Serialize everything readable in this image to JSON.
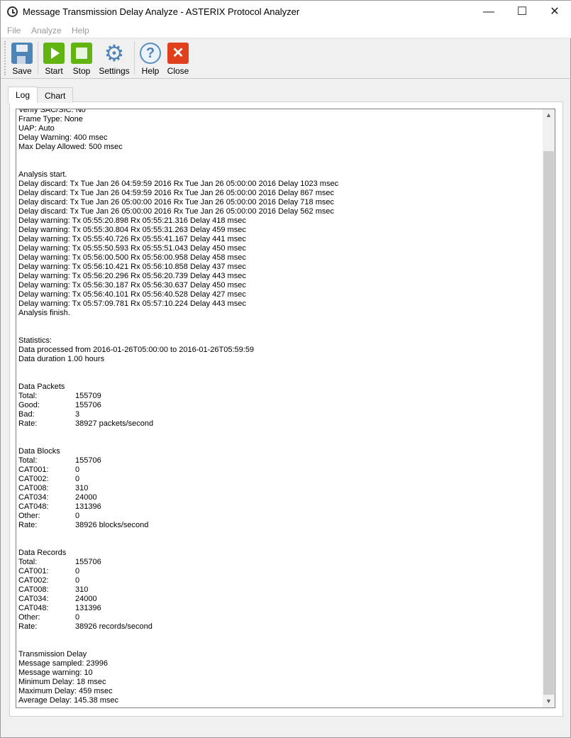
{
  "window": {
    "title": "Message Transmission Delay Analyze - ASTERIX Protocol Analyzer",
    "minimize": "—",
    "maximize": "☐",
    "close": "✕"
  },
  "menu": [
    "File",
    "Analyze",
    "Help"
  ],
  "toolbar": {
    "save": "Save",
    "start": "Start",
    "stop": "Stop",
    "settings": "Settings",
    "help": "Help",
    "close": "Close"
  },
  "tabs": [
    "Log",
    "Chart"
  ],
  "log": [
    {
      "t": "Verify SAC/SIC: No"
    },
    {
      "t": "Frame Type: None"
    },
    {
      "t": "UAP: Auto"
    },
    {
      "t": "Delay Warning: 400 msec"
    },
    {
      "t": "Max Delay Allowed: 500 msec"
    },
    {
      "t": ""
    },
    {
      "t": ""
    },
    {
      "t": "Analysis start."
    },
    {
      "t": "Delay discard: Tx Tue Jan 26 04:59:59 2016 Rx Tue Jan 26 05:00:00 2016 Delay 1023 msec"
    },
    {
      "t": "Delay discard: Tx Tue Jan 26 04:59:59 2016 Rx Tue Jan 26 05:00:00 2016 Delay 867 msec"
    },
    {
      "t": "Delay discard: Tx Tue Jan 26 05:00:00 2016 Rx Tue Jan 26 05:00:00 2016 Delay 718 msec"
    },
    {
      "t": "Delay discard: Tx Tue Jan 26 05:00:00 2016 Rx Tue Jan 26 05:00:00 2016 Delay 562 msec"
    },
    {
      "t": "Delay warning: Tx 05:55:20.898 Rx 05:55:21.316 Delay 418 msec"
    },
    {
      "t": "Delay warning: Tx 05:55:30.804 Rx 05:55:31.263 Delay 459 msec"
    },
    {
      "t": "Delay warning: Tx 05:55:40.726 Rx 05:55:41.167 Delay 441 msec"
    },
    {
      "t": "Delay warning: Tx 05:55:50.593 Rx 05:55:51.043 Delay 450 msec"
    },
    {
      "t": "Delay warning: Tx 05:56:00.500 Rx 05:56:00.958 Delay 458 msec"
    },
    {
      "t": "Delay warning: Tx 05:56:10.421 Rx 05:56:10.858 Delay 437 msec"
    },
    {
      "t": "Delay warning: Tx 05:56:20.296 Rx 05:56:20.739 Delay 443 msec"
    },
    {
      "t": "Delay warning: Tx 05:56:30.187 Rx 05:56:30.637 Delay 450 msec"
    },
    {
      "t": "Delay warning: Tx 05:56:40.101 Rx 05:56:40.528 Delay 427 msec"
    },
    {
      "t": "Delay warning: Tx 05:57:09.781 Rx 05:57:10.224 Delay 443 msec"
    },
    {
      "t": "Analysis finish."
    },
    {
      "t": ""
    },
    {
      "t": ""
    },
    {
      "t": "Statistics:"
    },
    {
      "t": "Data processed from 2016-01-26T05:00:00 to 2016-01-26T05:59:59"
    },
    {
      "t": "Data duration 1.00 hours"
    },
    {
      "t": ""
    },
    {
      "t": ""
    },
    {
      "t": "Data Packets"
    },
    {
      "k": "Total:",
      "v": "155709"
    },
    {
      "k": "Good:",
      "v": "155706"
    },
    {
      "k": "Bad:",
      "v": "3"
    },
    {
      "k": "Rate:",
      "v": "38927 packets/second"
    },
    {
      "t": ""
    },
    {
      "t": ""
    },
    {
      "t": "Data Blocks"
    },
    {
      "k": "Total:",
      "v": "155706"
    },
    {
      "k": "CAT001:",
      "v": "0"
    },
    {
      "k": "CAT002:",
      "v": "0"
    },
    {
      "k": "CAT008:",
      "v": "310"
    },
    {
      "k": "CAT034:",
      "v": "24000"
    },
    {
      "k": "CAT048:",
      "v": "131396"
    },
    {
      "k": "Other:",
      "v": "0"
    },
    {
      "k": "Rate:",
      "v": "38926 blocks/second"
    },
    {
      "t": ""
    },
    {
      "t": ""
    },
    {
      "t": "Data Records"
    },
    {
      "k": "Total:",
      "v": "155706"
    },
    {
      "k": "CAT001:",
      "v": "0"
    },
    {
      "k": "CAT002:",
      "v": "0"
    },
    {
      "k": "CAT008:",
      "v": "310"
    },
    {
      "k": "CAT034:",
      "v": "24000"
    },
    {
      "k": "CAT048:",
      "v": "131396"
    },
    {
      "k": "Other:",
      "v": "0"
    },
    {
      "k": "Rate:",
      "v": "38926 records/second"
    },
    {
      "t": ""
    },
    {
      "t": ""
    },
    {
      "t": "Transmission Delay"
    },
    {
      "t": "Message sampled: 23996"
    },
    {
      "t": "Message warning: 10"
    },
    {
      "t": "Minimum Delay: 18 msec"
    },
    {
      "t": "Maximum Delay: 459 msec"
    },
    {
      "t": "Average Delay: 145.38 msec"
    }
  ]
}
